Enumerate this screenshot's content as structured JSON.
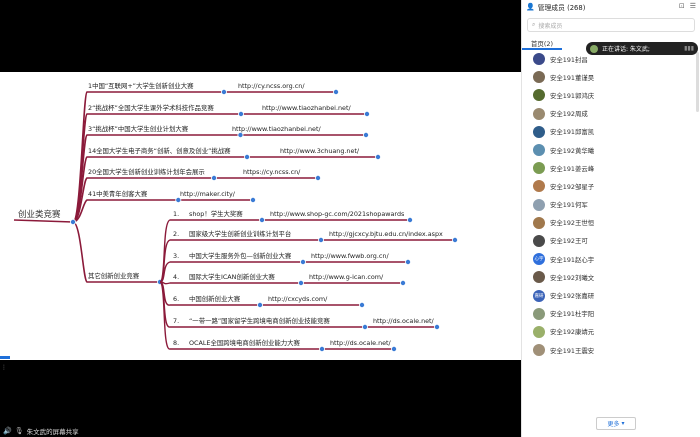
{
  "sidebar": {
    "title": "管理成员 (268)",
    "search_placeholder": "搜索成员",
    "tab_label": "首页(2)",
    "speaking_label": "正在讲话: 朱文武;",
    "more_label": "更多",
    "members": [
      {
        "name": "安全191封昌",
        "color": "#3b4a8a"
      },
      {
        "name": "安全191董谨昊",
        "color": "#7a6a55"
      },
      {
        "name": "安全191郭鸿庆",
        "color": "#556b2f"
      },
      {
        "name": "安全192周成",
        "color": "#9a8a70"
      },
      {
        "name": "安全191邱富凯",
        "color": "#2f5d8a"
      },
      {
        "name": "安全192黄华曦",
        "color": "#5c8fb0"
      },
      {
        "name": "安全191姜云峰",
        "color": "#7b9c52"
      },
      {
        "name": "安全192邹星子",
        "color": "#b07a4c"
      },
      {
        "name": "安全191何军",
        "color": "#8fa0b0"
      },
      {
        "name": "安全192王世恒",
        "color": "#a0784c"
      },
      {
        "name": "安全192王可",
        "color": "#4a4a4a"
      },
      {
        "name": "安全191赵心宇",
        "color": "#2f6fdc"
      },
      {
        "name": "安全192刘曦文",
        "color": "#6a5a4a"
      },
      {
        "name": "安全192张嘉研",
        "color": "#3b63b8"
      },
      {
        "name": "安全191杜宇阳",
        "color": "#8a9a7a"
      },
      {
        "name": "安全192康靖元",
        "color": "#9ab06a"
      },
      {
        "name": "安全191王震安",
        "color": "#a09078"
      }
    ],
    "avatar_text": {
      "11": "心宇",
      "13": "嘉研"
    }
  },
  "share_bar": {
    "label": "朱文武的屏幕共享"
  },
  "mindmap": {
    "root": "创业类竞赛",
    "branches": [
      {
        "label": "1中国“互联网+”大学生创新创业大赛",
        "url": "http://cy.ncss.org.cn/"
      },
      {
        "label": "2“挑战杯”全国大学生课外学术科技作品竞赛",
        "url": "http://www.tiaozhanbei.net/"
      },
      {
        "label": "3“挑战杯”中国大学生创业计划大赛",
        "url": "http://www.tiaozhanbei.net/"
      },
      {
        "label": "14全国大学生电子商务“创新、创意及创业”挑战赛",
        "url": "http://www.3chuang.net/"
      },
      {
        "label": "20全国大学生创新创业训练计划年会展示",
        "url": "https://cy.ncss.cn/"
      },
      {
        "label": "41中美青年创客大赛",
        "url": "http://maker.city/"
      }
    ],
    "other": {
      "label": "其它创新创业竞赛",
      "items": [
        {
          "num": "1.",
          "label": "shop！学生大奖赛",
          "url": "http://www.shop-gc.com/2021shopawards"
        },
        {
          "num": "2.",
          "label": "国家级大学生创新创业训练计划平台",
          "url": "http://gjcxcy.bjtu.edu.cn/index.aspx"
        },
        {
          "num": "3.",
          "label": "中国大学生服务外包—创新创业大赛",
          "url": "http://www.fwwb.org.cn/"
        },
        {
          "num": "4.",
          "label": "国际大学生ICAN创新创业大赛",
          "url": "http://www.g-ican.com/"
        },
        {
          "num": "6.",
          "label": "中国创新创业大赛",
          "url": "http://cxcyds.com/"
        },
        {
          "num": "7.",
          "label": "“一带一路”国家留学生跨境电商创新创业技能竞赛",
          "url": "http://ds.ocale.net/"
        },
        {
          "num": "8.",
          "label": "OCALE全国跨境电商创新创业能力大赛",
          "url": "http://ds.ocale.net/"
        }
      ]
    }
  },
  "colors": {
    "branch": "#8b1a3a",
    "node": "#3a7bd5",
    "accent": "#1e6fd9"
  }
}
